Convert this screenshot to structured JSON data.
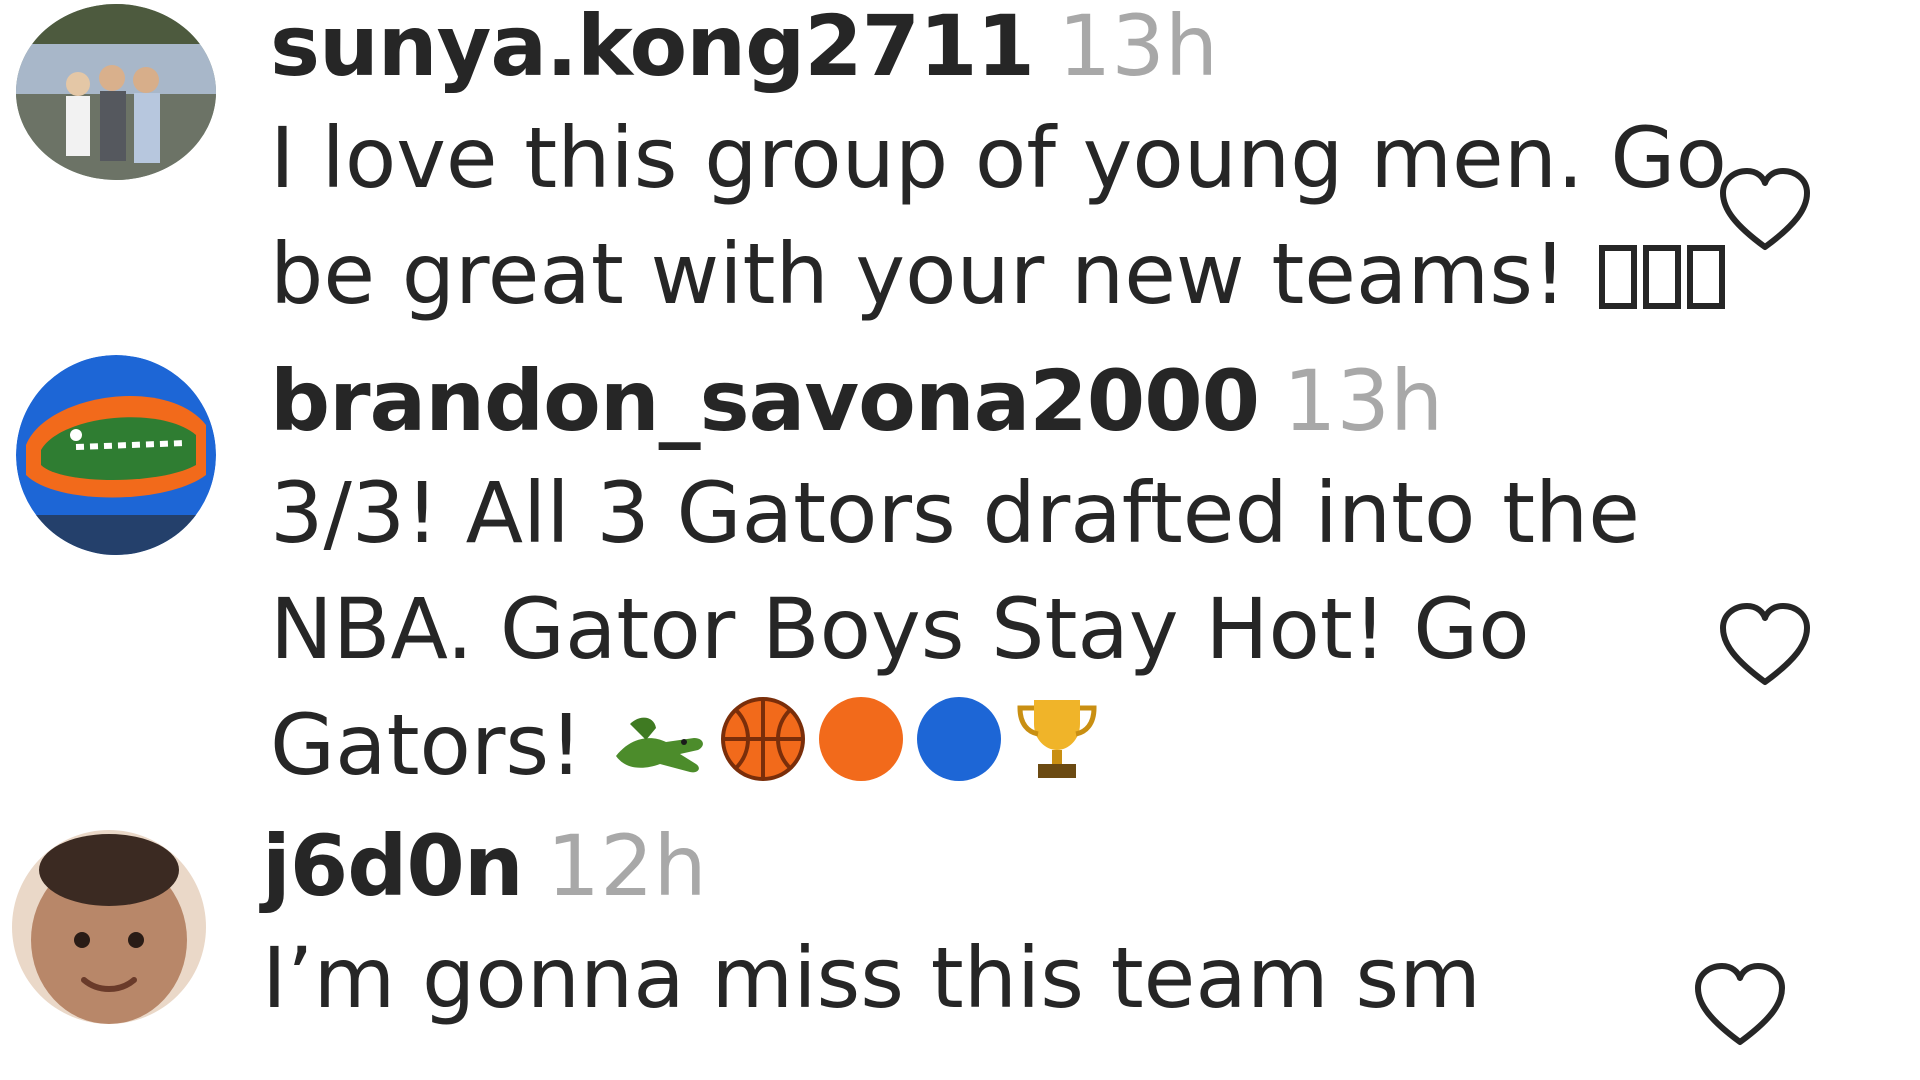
{
  "comments": [
    {
      "username": "sunya.kong2711",
      "time": "13h",
      "text": "I love this group of young men. Go be great with your new teams!",
      "trailing_glyphs": [
        "missing-glyph",
        "missing-glyph",
        "missing-glyph"
      ],
      "avatar": "family-photo-avatar",
      "like_icon": "heart-outline-icon"
    },
    {
      "username": "brandon_savona2000",
      "time": "13h",
      "text": "3/3! All 3 Gators drafted into the NBA. Gator Boys Stay Hot! Go Gators!",
      "trailing_glyphs": [
        "crocodile-emoji",
        "basketball-emoji",
        "orange-circle-emoji",
        "blue-circle-emoji",
        "trophy-emoji"
      ],
      "avatar": "gator-logo-avatar",
      "like_icon": "heart-outline-icon"
    },
    {
      "username": "j6d0n",
      "time": "12h",
      "text": "I’m gonna miss this team sm",
      "trailing_glyphs": [],
      "avatar": "child-face-avatar",
      "like_icon": "heart-outline-icon"
    }
  ],
  "colors": {
    "username": "#262626",
    "time": "#a8a8a8",
    "text": "#262626",
    "heart_outline": "#262626",
    "gator_orange": "#f26a1b",
    "gator_blue": "#1d66d6",
    "gator_green": "#2f7d32"
  }
}
